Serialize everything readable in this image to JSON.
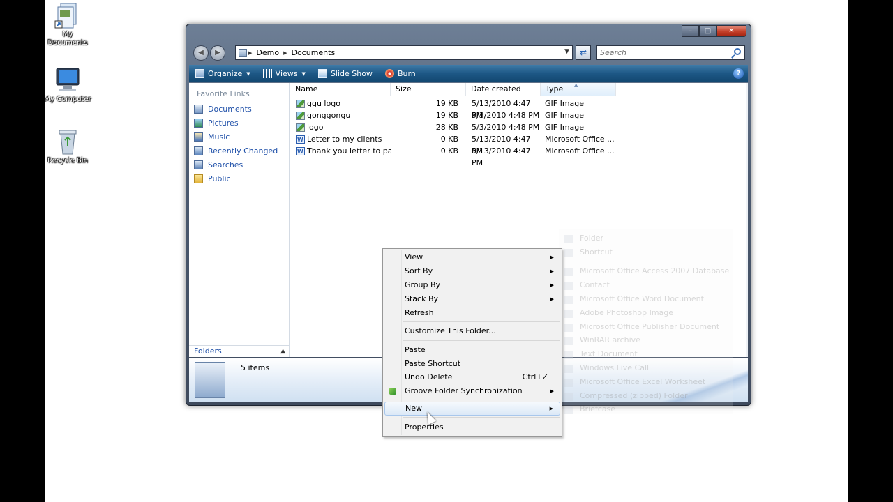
{
  "desktop": {
    "icons": [
      {
        "label": "My Documents"
      },
      {
        "label": "My Computer"
      },
      {
        "label": "Recycle Bin"
      }
    ]
  },
  "window": {
    "address": {
      "path": [
        "Demo",
        "Documents"
      ]
    },
    "search": {
      "placeholder": "Search"
    },
    "toolbar": {
      "organize": "Organize",
      "views": "Views",
      "slideshow": "Slide Show",
      "burn": "Burn"
    },
    "nav": {
      "favorite_links_title": "Favorite Links",
      "items": [
        {
          "label": "Documents",
          "icon": "documents-icon"
        },
        {
          "label": "Pictures",
          "icon": "pictures-icon"
        },
        {
          "label": "Music",
          "icon": "music-icon"
        },
        {
          "label": "Recently Changed",
          "icon": "recently-changed-icon"
        },
        {
          "label": "Searches",
          "icon": "searches-icon"
        },
        {
          "label": "Public",
          "icon": "public-folder-icon"
        }
      ],
      "folders_label": "Folders"
    },
    "columns": {
      "name": "Name",
      "size": "Size",
      "date": "Date created",
      "type": "Type"
    },
    "files": [
      {
        "name": "ggu logo",
        "size": "19 KB",
        "date": "5/13/2010 4:47 PM",
        "type": "GIF Image"
      },
      {
        "name": "gonggongu",
        "size": "19 KB",
        "date": "5/3/2010 4:48 PM",
        "type": "GIF Image"
      },
      {
        "name": "logo",
        "size": "28 KB",
        "date": "5/3/2010 4:48 PM",
        "type": "GIF Image"
      },
      {
        "name": "Letter to my clients",
        "size": "0 KB",
        "date": "5/13/2010 4:47 PM",
        "type": "Microsoft Office ..."
      },
      {
        "name": "Thank you letter to par...",
        "size": "0 KB",
        "date": "5/13/2010 4:47 PM",
        "type": "Microsoft Office ..."
      }
    ],
    "details": {
      "count": "5 items"
    }
  },
  "context_menu": {
    "view": "View",
    "sort_by": "Sort By",
    "group_by": "Group By",
    "stack_by": "Stack By",
    "refresh": "Refresh",
    "customize": "Customize This Folder...",
    "paste": "Paste",
    "paste_shortcut": "Paste Shortcut",
    "undo_delete": "Undo Delete",
    "undo_shortcut": "Ctrl+Z",
    "groove": "Groove Folder Synchronization",
    "new": "New",
    "properties": "Properties"
  },
  "new_submenu": {
    "items": [
      "Folder",
      "Shortcut",
      "Microsoft Office Access 2007 Database",
      "Contact",
      "Microsoft Office Word Document",
      "Adobe Photoshop Image",
      "Microsoft Office Publisher Document",
      "WinRAR archive",
      "Text Document",
      "Windows Live Call",
      "Microsoft Office Excel Worksheet",
      "Compressed (zipped) Folder",
      "Briefcase"
    ]
  },
  "colors": {
    "toolbar": "#1d5785",
    "link": "#1e4fa8",
    "menu_bg": "#f1f1f1",
    "highlight": "#dce9f7"
  }
}
